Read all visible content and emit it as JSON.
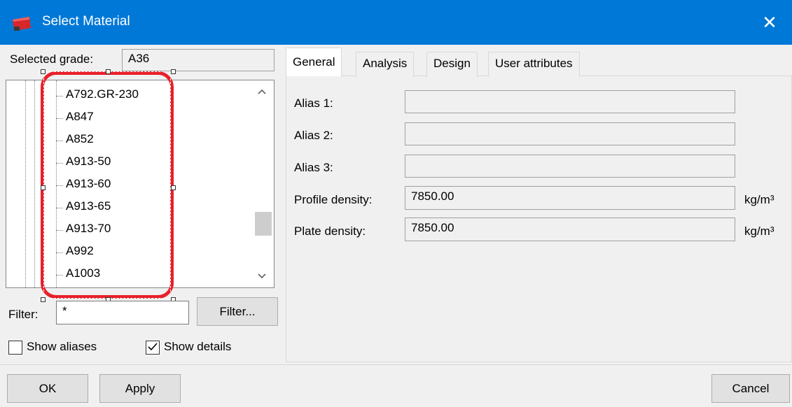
{
  "window": {
    "title": "Select Material",
    "close_glyph": "✕"
  },
  "selected_grade": {
    "label": "Selected grade:",
    "value": "A36"
  },
  "material_tree": {
    "items": [
      "A792.GR-230",
      "A847",
      "A852",
      "A913-50",
      "A913-60",
      "A913-65",
      "A913-70",
      "A992",
      "A1003"
    ]
  },
  "filter": {
    "label": "Filter:",
    "value": "*",
    "button_label": "Filter..."
  },
  "options": {
    "show_aliases": {
      "label": "Show aliases",
      "checked": false
    },
    "show_details": {
      "label": "Show details",
      "checked": true
    }
  },
  "tabs": [
    {
      "label": "General",
      "active": true
    },
    {
      "label": "Analysis",
      "active": false
    },
    {
      "label": "Design",
      "active": false
    },
    {
      "label": "User attributes",
      "active": false
    }
  ],
  "general": {
    "alias1": {
      "label": "Alias 1:",
      "value": ""
    },
    "alias2": {
      "label": "Alias 2:",
      "value": ""
    },
    "alias3": {
      "label": "Alias 3:",
      "value": ""
    },
    "profile_density": {
      "label": "Profile density:",
      "value": "7850.00",
      "unit": "kg/m³"
    },
    "plate_density": {
      "label": "Plate density:",
      "value": "7850.00",
      "unit": "kg/m³"
    }
  },
  "footer": {
    "ok_label": "OK",
    "apply_label": "Apply",
    "cancel_label": "Cancel"
  },
  "colors": {
    "titlebar": "#0078d7",
    "highlight": "#e8202a"
  },
  "icons": {
    "app": "material-icon",
    "close": "close-icon",
    "scroll_up": "chevron-up-icon",
    "scroll_down": "chevron-down-icon",
    "check": "checkmark-icon"
  }
}
